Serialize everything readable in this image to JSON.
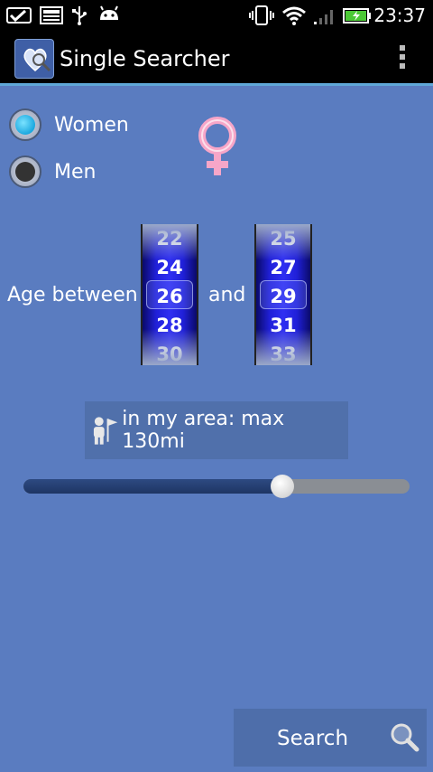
{
  "status_bar": {
    "time": "23:37",
    "icons": [
      "notification-check-icon",
      "image-icon",
      "usb-icon",
      "android-icon",
      "vibrate-icon",
      "wifi-icon",
      "signal-icon",
      "battery-charging-icon"
    ]
  },
  "action_bar": {
    "title": "Single Searcher",
    "logo_icon": "heart-search-logo-icon",
    "menu_icon": "overflow-menu-icon"
  },
  "gender": {
    "options": [
      {
        "label": "Women",
        "checked": true
      },
      {
        "label": "Men",
        "checked": false
      }
    ],
    "symbol_icon": "venus-icon",
    "symbol_color": "#f7a6c8"
  },
  "age": {
    "label": "Age between",
    "and_label": "and",
    "min_picker": {
      "values": [
        "22",
        "24",
        "26",
        "28",
        "30"
      ],
      "selected": "26"
    },
    "max_picker": {
      "values": [
        "25",
        "27",
        "29",
        "31",
        "33"
      ],
      "selected": "29"
    }
  },
  "area": {
    "icon": "person-flag-icon",
    "label": "in my area: max 130mi",
    "slider_fraction": 0.67
  },
  "search": {
    "label": "Search",
    "icon": "magnifier-icon"
  },
  "colors": {
    "background": "#5a7cc0",
    "picker": "#2f2ff2",
    "accent": "#1ba8df"
  }
}
